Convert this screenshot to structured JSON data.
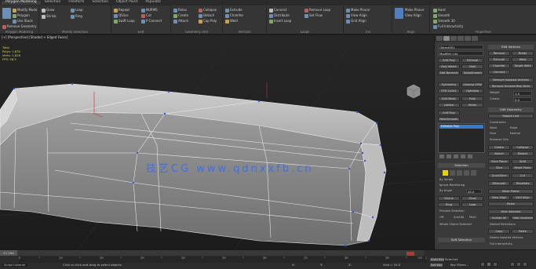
{
  "menu": [
    "Polygon Modeling",
    "Selection",
    "Freeform",
    "Selection",
    "Object Paint",
    "Populate"
  ],
  "ribbon": {
    "groups": [
      {
        "label": "Polygon Modeling",
        "items": [
          "Modify Mode",
          "Polygon",
          "Use Stack",
          "Remove Geometry"
        ]
      },
      {
        "label": "Modify Selection",
        "items": [
          "Grow",
          "Shrink",
          "Loop",
          "Ring"
        ]
      },
      {
        "label": "Edit",
        "items": [
          "Repeat",
          "QSlice",
          "Swift Loop",
          "NURMS",
          "Cut",
          "P Connect",
          "Constraints"
        ]
      },
      {
        "label": "Geometry (All)",
        "items": [
          "Relax",
          "Create",
          "Attach",
          "Collapse",
          "Detach",
          "Cap Poly"
        ]
      },
      {
        "label": "Vertices",
        "items": [
          "Extrude",
          "Chamfer",
          "Weld",
          "Remove",
          "Break",
          "Target Weld"
        ]
      },
      {
        "label": "Loops",
        "items": [
          "Connect",
          "Distribute",
          "Insert Loop",
          "Remove Loop",
          "Set Flow"
        ]
      },
      {
        "label": "Tris",
        "items": [
          "Make Planar",
          "View Align",
          "Grid Align",
          "Relax"
        ]
      },
      {
        "label": "Align",
        "items": [
          "Make Planar",
          "View Align",
          "To View",
          "To Grid"
        ]
      },
      {
        "label": "Properties",
        "items": [
          "Hard",
          "Smooth",
          "Smooth 30",
          "Full Interactivity"
        ]
      }
    ]
  },
  "viewport": {
    "label": "[+] [Perspective] [Shaded + Edged Faces]",
    "stats": [
      "Total",
      "Polys: 1,832",
      "Verts: 1,826",
      "FPS: 58.5"
    ],
    "axis_label": "Z"
  },
  "watermark": "技艺CG  www.qdnxxfb.cn",
  "command_panel": {
    "object_name": "Object001",
    "modifier_list": "Modifier List",
    "left_buttons": [
      "Edit Poly",
      "Extrude",
      "Poly Select",
      "Shell",
      "Edit Normals",
      "TurboSmooth",
      "Symmetry",
      "Unwrap UVW",
      "FFD 2x2x2",
      "Optimize",
      "Edit Mesh",
      "Push",
      "Lattice",
      "Relax"
    ],
    "right_buttons": [
      "Edit Poly",
      "MeshSmooth",
      "Chamfer",
      "Bend",
      "Noise"
    ],
    "stack_selected": "Editable Poly",
    "selection_label": "Selection",
    "soft_selection": "Soft Selection",
    "edit_geometry": "Edit Geometry",
    "checks": [
      "By Vertex",
      "Ignore Backfacing",
      "By Angle"
    ],
    "angle_value": "45.0",
    "shrink": "Shrink",
    "grow": "Grow",
    "ring": "Ring",
    "loop": "Loop",
    "preview": "Preview Selection",
    "off": "Off",
    "subobj": "SubObj",
    "multi": "Multi",
    "whole_object": "Whole Object Selected",
    "right_col": [
      "Edit Vertices",
      "Remove",
      "Break",
      "Extrude",
      "Weld",
      "Chamfer",
      "Target Weld",
      "Connect",
      "Remove Isolated Vertices",
      "Remove Unused Map Verts",
      "Weight",
      "Crease"
    ],
    "geom": [
      "Repeat Last",
      "Constraints",
      "None",
      "Edge",
      "Face",
      "Normal",
      "Preserve UVs",
      "Create",
      "Collapse",
      "Attach",
      "Detach",
      "Slice Plane",
      "Split",
      "Slice",
      "Reset Plane",
      "QuickSlice",
      "Cut",
      "MSmooth",
      "Tessellate",
      "Make Planar",
      "View Align",
      "Grid Align",
      "Relax",
      "Hide Selected",
      "Unhide All",
      "Hide Unselected",
      "Named Selections:",
      "Copy",
      "Paste",
      "Delete Isolated Vertices",
      "Full Interactivity"
    ],
    "value_a": "0.0",
    "value_b": "1.0",
    "value_c": "0.0"
  },
  "timeline": {
    "slider_label": "0 / 100",
    "ticks": [
      "0",
      "5",
      "10",
      "15",
      "20",
      "25",
      "30",
      "35",
      "40",
      "45",
      "50",
      "55",
      "60",
      "65",
      "70",
      "75",
      "80",
      "85",
      "90",
      "95",
      "100"
    ]
  },
  "status": {
    "left": "Script Listener",
    "middle": "Click or click-and-drag to select objects",
    "coord_x": "X:",
    "coord_y": "Y:",
    "coord_z": "Z:",
    "grid": "Grid = 10.0",
    "auto_key": "Auto Key",
    "selected": "Selected",
    "set_key": "Set Key",
    "key_filters": "Key Filters..."
  },
  "colors": {
    "accent": "#3a78c9",
    "watermark": "#3f6fe8",
    "stats": "#d8d84a",
    "spline_red": "#d04040",
    "vertex_blue": "#3355dd"
  }
}
